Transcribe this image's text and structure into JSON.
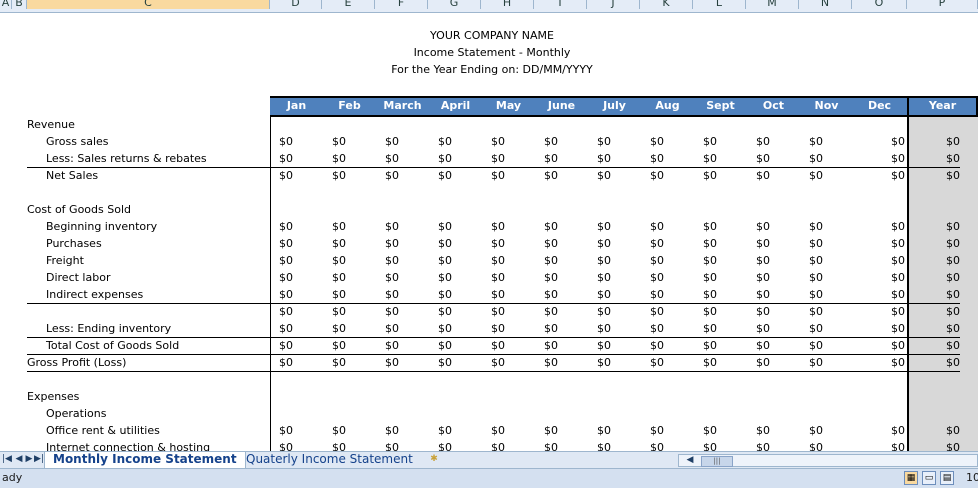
{
  "columns": [
    "A",
    "B",
    "C",
    "D",
    "E",
    "F",
    "G",
    "H",
    "I",
    "J",
    "K",
    "L",
    "M",
    "N",
    "O",
    "P"
  ],
  "selected_column": "C",
  "title": {
    "company": "YOUR COMPANY NAME",
    "statement": "Income Statement - Monthly",
    "period": "For the Year Ending on: DD/MM/YYYY"
  },
  "months": [
    "Jan",
    "Feb",
    "March",
    "April",
    "May",
    "June",
    "July",
    "Aug",
    "Sept",
    "Oct",
    "Nov",
    "Dec"
  ],
  "year_label": "Year",
  "rows": [
    {
      "label": "Revenue",
      "indent": 0,
      "values": false
    },
    {
      "label": "Gross sales",
      "indent": 1,
      "values": true
    },
    {
      "label": "Less: Sales returns & rebates",
      "indent": 1,
      "values": true
    },
    {
      "label": "Net Sales",
      "indent": 1,
      "values": true,
      "line_above": true
    },
    {
      "label": "",
      "indent": 0,
      "values": false
    },
    {
      "label": "Cost of Goods Sold",
      "indent": 0,
      "values": false
    },
    {
      "label": "Beginning inventory",
      "indent": 1,
      "values": true
    },
    {
      "label": "Purchases",
      "indent": 1,
      "values": true
    },
    {
      "label": "Freight",
      "indent": 1,
      "values": true
    },
    {
      "label": "Direct labor",
      "indent": 1,
      "values": true
    },
    {
      "label": "Indirect expenses",
      "indent": 1,
      "values": true
    },
    {
      "label": "",
      "indent": 1,
      "values": true,
      "line_above": true
    },
    {
      "label": "Less: Ending inventory",
      "indent": 1,
      "values": true
    },
    {
      "label": "Total Cost of Goods Sold",
      "indent": 1,
      "values": true,
      "line_above": true
    },
    {
      "label": "Gross Profit (Loss)",
      "indent": 0,
      "values": true,
      "line_above": true
    },
    {
      "label": "",
      "indent": 0,
      "values": false,
      "line_above": true
    },
    {
      "label": "Expenses",
      "indent": 0,
      "values": false
    },
    {
      "label": "Operations",
      "indent": 1,
      "values": false
    },
    {
      "label": "Office rent & utilities",
      "indent": 1,
      "values": true
    },
    {
      "label": "Internet connection & hosting",
      "indent": 1,
      "values": true
    }
  ],
  "cell_value": "$0",
  "sheet_tabs": {
    "active": "Monthly Income Statement",
    "other": "Quaterly Income Statement"
  },
  "status": {
    "text": "ady",
    "zoom": "10"
  }
}
